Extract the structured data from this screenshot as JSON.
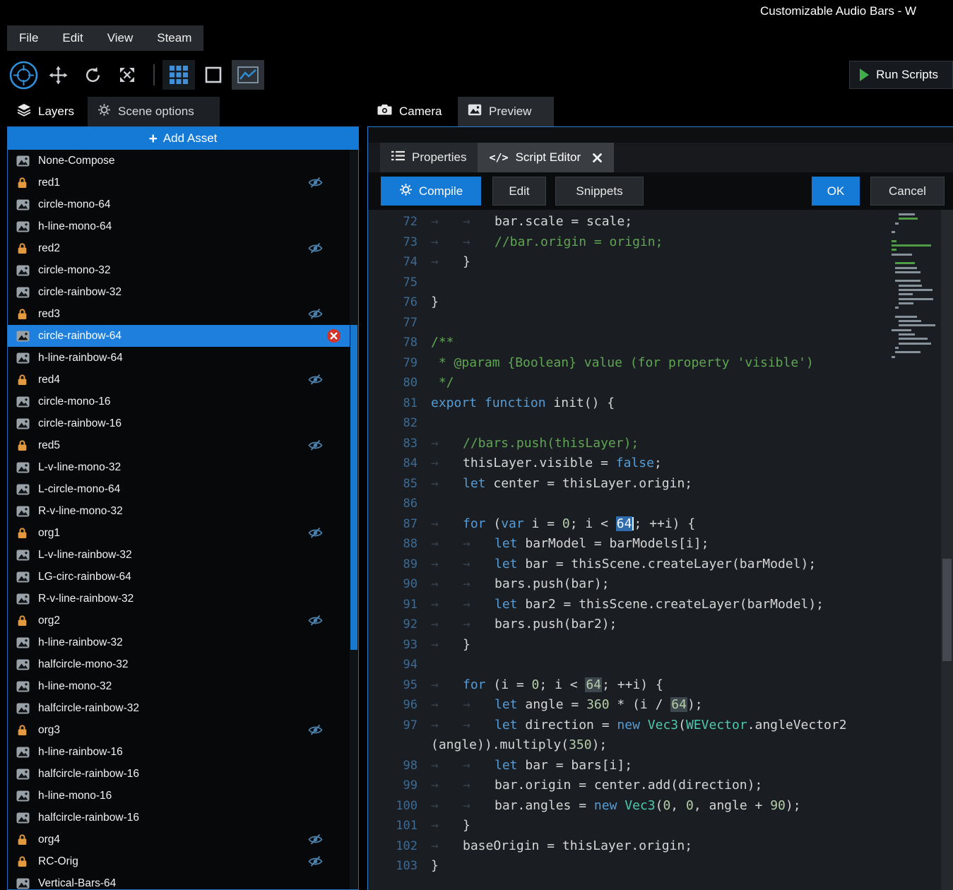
{
  "window": {
    "title": "Customizable Audio Bars - W"
  },
  "menu": {
    "items": [
      "File",
      "Edit",
      "View",
      "Steam"
    ]
  },
  "toolbar": {
    "run_scripts_label": "Run Scripts"
  },
  "left_tabs": {
    "layers_label": "Layers",
    "scene_options_label": "Scene options"
  },
  "view_tabs": {
    "camera_label": "Camera",
    "preview_label": "Preview"
  },
  "icons": {
    "code_tab_glyph": "</>",
    "add_asset_plus": "+"
  },
  "layers": {
    "add_asset_label": "Add Asset",
    "items": [
      {
        "label": "None-Compose",
        "icon": "image-icon",
        "hidden": false,
        "selected": false
      },
      {
        "label": "red1",
        "icon": "lock-icon",
        "hidden": true,
        "selected": false
      },
      {
        "label": "circle-mono-64",
        "icon": "image-icon",
        "hidden": false,
        "selected": false
      },
      {
        "label": "h-line-mono-64",
        "icon": "image-icon",
        "hidden": false,
        "selected": false
      },
      {
        "label": "red2",
        "icon": "lock-icon",
        "hidden": true,
        "selected": false
      },
      {
        "label": "circle-mono-32",
        "icon": "image-icon",
        "hidden": false,
        "selected": false
      },
      {
        "label": "circle-rainbow-32",
        "icon": "image-icon",
        "hidden": false,
        "selected": false
      },
      {
        "label": "red3",
        "icon": "lock-icon",
        "hidden": true,
        "selected": false
      },
      {
        "label": "circle-rainbow-64",
        "icon": "image-icon",
        "hidden": false,
        "selected": true
      },
      {
        "label": "h-line-rainbow-64",
        "icon": "image-icon",
        "hidden": false,
        "selected": false
      },
      {
        "label": "red4",
        "icon": "lock-icon",
        "hidden": true,
        "selected": false
      },
      {
        "label": "circle-mono-16",
        "icon": "image-icon",
        "hidden": false,
        "selected": false
      },
      {
        "label": "circle-rainbow-16",
        "icon": "image-icon",
        "hidden": false,
        "selected": false
      },
      {
        "label": "red5",
        "icon": "lock-icon",
        "hidden": true,
        "selected": false
      },
      {
        "label": "L-v-line-mono-32",
        "icon": "image-icon",
        "hidden": false,
        "selected": false
      },
      {
        "label": "L-circle-mono-64",
        "icon": "image-icon",
        "hidden": false,
        "selected": false
      },
      {
        "label": "R-v-line-mono-32",
        "icon": "image-icon",
        "hidden": false,
        "selected": false
      },
      {
        "label": "org1",
        "icon": "lock-icon",
        "hidden": true,
        "selected": false
      },
      {
        "label": "L-v-line-rainbow-32",
        "icon": "image-icon",
        "hidden": false,
        "selected": false
      },
      {
        "label": "LG-circ-rainbow-64",
        "icon": "image-icon",
        "hidden": false,
        "selected": false
      },
      {
        "label": "R-v-line-rainbow-32",
        "icon": "image-icon",
        "hidden": false,
        "selected": false
      },
      {
        "label": "org2",
        "icon": "lock-icon",
        "hidden": true,
        "selected": false
      },
      {
        "label": "h-line-rainbow-32",
        "icon": "image-icon",
        "hidden": false,
        "selected": false
      },
      {
        "label": "halfcircle-mono-32",
        "icon": "image-icon",
        "hidden": false,
        "selected": false
      },
      {
        "label": "h-line-mono-32",
        "icon": "image-icon",
        "hidden": false,
        "selected": false
      },
      {
        "label": "halfcircle-rainbow-32",
        "icon": "image-icon",
        "hidden": false,
        "selected": false
      },
      {
        "label": "org3",
        "icon": "lock-icon",
        "hidden": true,
        "selected": false
      },
      {
        "label": "h-line-rainbow-16",
        "icon": "image-icon",
        "hidden": false,
        "selected": false
      },
      {
        "label": "halfcircle-rainbow-16",
        "icon": "image-icon",
        "hidden": false,
        "selected": false
      },
      {
        "label": "h-line-mono-16",
        "icon": "image-icon",
        "hidden": false,
        "selected": false
      },
      {
        "label": "halfcircle-rainbow-16",
        "icon": "image-icon",
        "hidden": false,
        "selected": false
      },
      {
        "label": "org4",
        "icon": "lock-icon",
        "hidden": true,
        "selected": false
      },
      {
        "label": "RC-Orig",
        "icon": "lock-icon",
        "hidden": true,
        "selected": false
      },
      {
        "label": "Vertical-Bars-64",
        "icon": "image-icon",
        "hidden": false,
        "selected": false
      }
    ]
  },
  "editor": {
    "tabs": {
      "properties_label": "Properties",
      "script_editor_label": "Script Editor"
    },
    "buttons": {
      "compile_label": "Compile",
      "edit_label": "Edit",
      "snippets_label": "Snippets",
      "ok_label": "OK",
      "cancel_label": "Cancel"
    },
    "code": {
      "first_line_number": 72,
      "lines": [
        {
          "n": "72",
          "tk": [
            [
              "tab",
              "→"
            ],
            [
              "tab",
              "→"
            ],
            [
              "pl",
              "bar.scale = scale;"
            ]
          ]
        },
        {
          "n": "73",
          "tk": [
            [
              "tab",
              "→"
            ],
            [
              "tab",
              "→"
            ],
            [
              "cm",
              "//bar.origin = origin;"
            ]
          ]
        },
        {
          "n": "74",
          "tk": [
            [
              "tab",
              "→"
            ],
            [
              "pl",
              "}"
            ]
          ]
        },
        {
          "n": "75",
          "tk": []
        },
        {
          "n": "76",
          "tk": [
            [
              "pl",
              "}"
            ]
          ]
        },
        {
          "n": "77",
          "tk": []
        },
        {
          "n": "78",
          "tk": [
            [
              "cm",
              "/**"
            ]
          ]
        },
        {
          "n": "79",
          "tk": [
            [
              "pl",
              " "
            ],
            [
              "cm",
              "* @param {Boolean} value (for property 'visible')"
            ]
          ]
        },
        {
          "n": "80",
          "tk": [
            [
              "pl",
              " "
            ],
            [
              "cm",
              "*/"
            ]
          ]
        },
        {
          "n": "81",
          "tk": [
            [
              "kw",
              "export"
            ],
            [
              "pl",
              " "
            ],
            [
              "kw",
              "function"
            ],
            [
              "pl",
              " init() {"
            ]
          ]
        },
        {
          "n": "82",
          "tk": []
        },
        {
          "n": "83",
          "tk": [
            [
              "tab",
              "→"
            ],
            [
              "cm",
              "//bars.push(thisLayer);"
            ]
          ]
        },
        {
          "n": "84",
          "tk": [
            [
              "tab",
              "→"
            ],
            [
              "pl",
              "thisLayer.visible = "
            ],
            [
              "kw",
              "false"
            ],
            [
              "pl",
              ";"
            ]
          ]
        },
        {
          "n": "85",
          "tk": [
            [
              "tab",
              "→"
            ],
            [
              "kw",
              "let"
            ],
            [
              "pl",
              " center = thisLayer.origin;"
            ]
          ]
        },
        {
          "n": "86",
          "tk": []
        },
        {
          "n": "87",
          "tk": [
            [
              "tab",
              "→"
            ],
            [
              "kw",
              "for"
            ],
            [
              "pl",
              " ("
            ],
            [
              "kw",
              "var"
            ],
            [
              "pl",
              " i = "
            ],
            [
              "num",
              "0"
            ],
            [
              "pl",
              "; i < "
            ],
            [
              "sel",
              "64"
            ],
            [
              "caret",
              ""
            ],
            [
              "pl",
              "; ++i) {"
            ]
          ]
        },
        {
          "n": "88",
          "tk": [
            [
              "tab",
              "→"
            ],
            [
              "tab",
              "→"
            ],
            [
              "kw",
              "let"
            ],
            [
              "pl",
              " barModel = barModels[i];"
            ]
          ]
        },
        {
          "n": "89",
          "tk": [
            [
              "tab",
              "→"
            ],
            [
              "tab",
              "→"
            ],
            [
              "kw",
              "let"
            ],
            [
              "pl",
              " bar = thisScene.createLayer(barModel);"
            ]
          ]
        },
        {
          "n": "90",
          "tk": [
            [
              "tab",
              "→"
            ],
            [
              "tab",
              "→"
            ],
            [
              "pl",
              "bars.push(bar);"
            ]
          ]
        },
        {
          "n": "91",
          "tk": [
            [
              "tab",
              "→"
            ],
            [
              "tab",
              "→"
            ],
            [
              "kw",
              "let"
            ],
            [
              "pl",
              " bar2 = thisScene.createLayer(barModel);"
            ]
          ]
        },
        {
          "n": "92",
          "tk": [
            [
              "tab",
              "→"
            ],
            [
              "tab",
              "→"
            ],
            [
              "pl",
              "bars.push(bar2);"
            ]
          ]
        },
        {
          "n": "93",
          "tk": [
            [
              "tab",
              "→"
            ],
            [
              "pl",
              "}"
            ]
          ]
        },
        {
          "n": "94",
          "tk": []
        },
        {
          "n": "95",
          "tk": [
            [
              "tab",
              "→"
            ],
            [
              "kw",
              "for"
            ],
            [
              "pl",
              " (i = "
            ],
            [
              "num",
              "0"
            ],
            [
              "pl",
              "; i < "
            ],
            [
              "occ",
              "64"
            ],
            [
              "pl",
              "; ++i) {"
            ]
          ]
        },
        {
          "n": "96",
          "tk": [
            [
              "tab",
              "→"
            ],
            [
              "tab",
              "→"
            ],
            [
              "kw",
              "let"
            ],
            [
              "pl",
              " angle = "
            ],
            [
              "num",
              "360"
            ],
            [
              "pl",
              " * (i / "
            ],
            [
              "occ",
              "64"
            ],
            [
              "pl",
              ");"
            ]
          ]
        },
        {
          "n": "97",
          "tk": [
            [
              "tab",
              "→"
            ],
            [
              "tab",
              "→"
            ],
            [
              "kw",
              "let"
            ],
            [
              "pl",
              " direction = "
            ],
            [
              "kw",
              "new"
            ],
            [
              "pl",
              " "
            ],
            [
              "ty",
              "Vec3"
            ],
            [
              "pl",
              "("
            ],
            [
              "ty",
              "WEVector"
            ],
            [
              "pl",
              ".angleVector2"
            ]
          ]
        },
        {
          "n": "",
          "tk": [
            [
              "pl",
              "(angle)).multiply("
            ],
            [
              "num",
              "350"
            ],
            [
              "pl",
              ");"
            ]
          ]
        },
        {
          "n": "98",
          "tk": [
            [
              "tab",
              "→"
            ],
            [
              "tab",
              "→"
            ],
            [
              "kw",
              "let"
            ],
            [
              "pl",
              " bar = bars[i];"
            ]
          ]
        },
        {
          "n": "99",
          "tk": [
            [
              "tab",
              "→"
            ],
            [
              "tab",
              "→"
            ],
            [
              "pl",
              "bar.origin = center.add(direction);"
            ]
          ]
        },
        {
          "n": "100",
          "tk": [
            [
              "tab",
              "→"
            ],
            [
              "tab",
              "→"
            ],
            [
              "pl",
              "bar.angles = "
            ],
            [
              "kw",
              "new"
            ],
            [
              "pl",
              " "
            ],
            [
              "ty",
              "Vec3"
            ],
            [
              "pl",
              "("
            ],
            [
              "num",
              "0"
            ],
            [
              "pl",
              ", "
            ],
            [
              "num",
              "0"
            ],
            [
              "pl",
              ", angle + "
            ],
            [
              "num",
              "90"
            ],
            [
              "pl",
              ");"
            ]
          ]
        },
        {
          "n": "101",
          "tk": [
            [
              "tab",
              "→"
            ],
            [
              "pl",
              "}"
            ]
          ]
        },
        {
          "n": "102",
          "tk": [
            [
              "tab",
              "→"
            ],
            [
              "pl",
              "baseOrigin = thisLayer.origin;"
            ]
          ]
        },
        {
          "n": "103",
          "tk": [
            [
              "pl",
              "}"
            ]
          ]
        }
      ]
    }
  },
  "colors": {
    "accent_blue": "#1579d6",
    "selection_blue": "#2e6cab",
    "lock_orange": "#e2993f",
    "eye_blue": "#4d82ad",
    "run_green": "#3fae4a",
    "comment_green": "#5fa553",
    "keyword_blue": "#569cd6",
    "number_green": "#b5cea8",
    "type_teal": "#4ec9b0",
    "close_red": "#d2342a"
  }
}
